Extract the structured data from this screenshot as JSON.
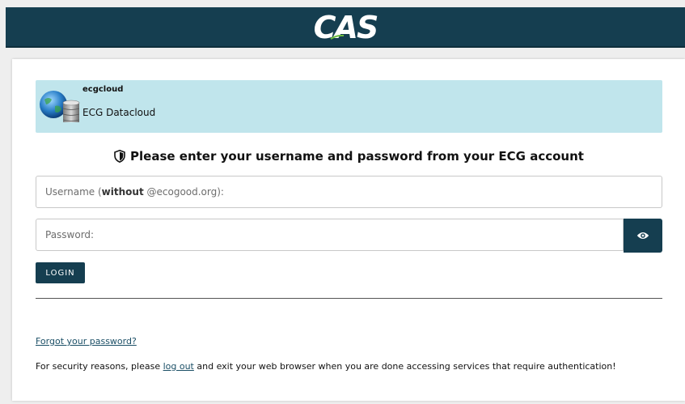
{
  "header": {
    "logo_text": "CAS",
    "background_color": "#153e50"
  },
  "service": {
    "name": "ecgcloud",
    "description": "ECG Datacloud",
    "icon": "globe-database-icon",
    "background_color": "#c0e5ec"
  },
  "login": {
    "heading_icon": "shield-icon",
    "heading": "Please enter your username and password from your ECG account",
    "username_placeholder_prefix": "Username (",
    "username_placeholder_bold": "without",
    "username_placeholder_suffix": " @ecogood.org):",
    "username_value": "",
    "password_placeholder": "Password:",
    "password_value": "",
    "show_password_icon": "eye-icon",
    "login_button_label": "LOGIN",
    "accent_color": "#153e50"
  },
  "footer": {
    "forgot_password_link": "Forgot your password?",
    "security_prefix": "For security reasons, please ",
    "logout_link": "log out",
    "security_suffix": " and exit your web browser when you are done accessing services that require authentication!",
    "link_color": "#1b4f66"
  }
}
